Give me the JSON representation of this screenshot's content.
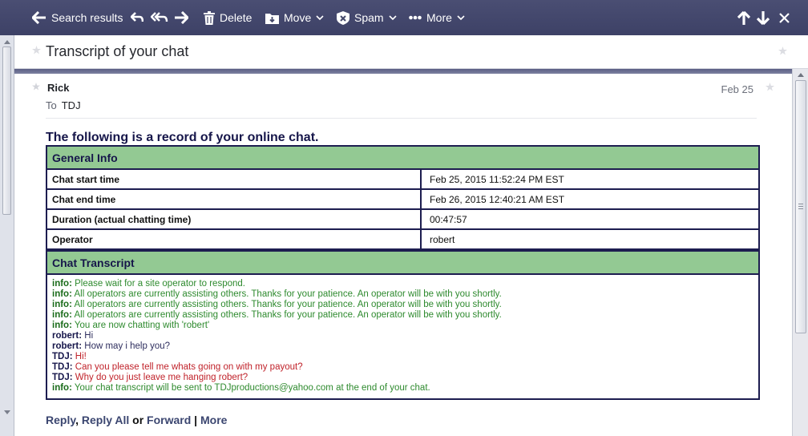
{
  "toolbar": {
    "back_label": "Search results",
    "delete_label": "Delete",
    "move_label": "Move",
    "spam_label": "Spam",
    "more_label": "More"
  },
  "subject": "Transcript of your chat",
  "message": {
    "sender": "Rick",
    "to_label": "To",
    "to_name": "TDJ",
    "date": "Feb 25",
    "heading": "The following is a record of your online chat."
  },
  "general_info": {
    "header": "General Info",
    "rows": [
      {
        "label": "Chat start time",
        "value": "Feb 25, 2015 11:52:24 PM EST"
      },
      {
        "label": "Chat end time",
        "value": "Feb 26, 2015 12:40:21 AM EST"
      },
      {
        "label": "Duration (actual chatting time)",
        "value": "00:47:57"
      },
      {
        "label": "Operator",
        "value": "robert"
      }
    ]
  },
  "transcript": {
    "header": "Chat Transcript",
    "lines": [
      {
        "speaker": "info:",
        "text": "Please wait for a site operator to respond.",
        "role": "info"
      },
      {
        "speaker": "info:",
        "text": "All operators are currently assisting others. Thanks for your patience. An operator will be with you shortly.",
        "role": "info"
      },
      {
        "speaker": "info:",
        "text": "All operators are currently assisting others. Thanks for your patience. An operator will be with you shortly.",
        "role": "info"
      },
      {
        "speaker": "info:",
        "text": "All operators are currently assisting others. Thanks for your patience. An operator will be with you shortly.",
        "role": "info"
      },
      {
        "speaker": "info:",
        "text": "You are now chatting with 'robert'",
        "role": "info"
      },
      {
        "speaker": "robert:",
        "text": "Hi",
        "role": "robert"
      },
      {
        "speaker": "robert:",
        "text": "How may i help you?",
        "role": "robert"
      },
      {
        "speaker": "TDJ:",
        "text": "Hi!",
        "role": "tdj"
      },
      {
        "speaker": "TDJ:",
        "text": "Can you please tell me whats going on with my payout?",
        "role": "tdj"
      },
      {
        "speaker": "TDJ:",
        "text": "Why do you just leave me hanging robert?",
        "role": "tdj"
      },
      {
        "speaker": "info:",
        "text": "Your chat transcript will be sent to TDJproductions@yahoo.com at the end of your chat.",
        "role": "info"
      }
    ]
  },
  "actions": {
    "reply": "Reply",
    "comma": ",",
    "reply_all": "Reply All",
    "or": "or",
    "forward": "Forward",
    "pipe": "|",
    "more": "More"
  },
  "colors": {
    "toolbar_bg": "#434769",
    "section_header_bg": "#93c993",
    "table_border": "#1d1d50",
    "info_text": "#2e8a2e",
    "tdj_text": "#c0222a",
    "link": "#3b4670"
  },
  "icons": [
    "back-arrow-icon",
    "reply-icon",
    "reply-all-icon",
    "forward-icon",
    "trash-icon",
    "move-folder-icon",
    "spam-shield-icon",
    "more-dots-icon",
    "arrow-up-icon",
    "arrow-down-icon",
    "close-icon",
    "star-icon"
  ]
}
